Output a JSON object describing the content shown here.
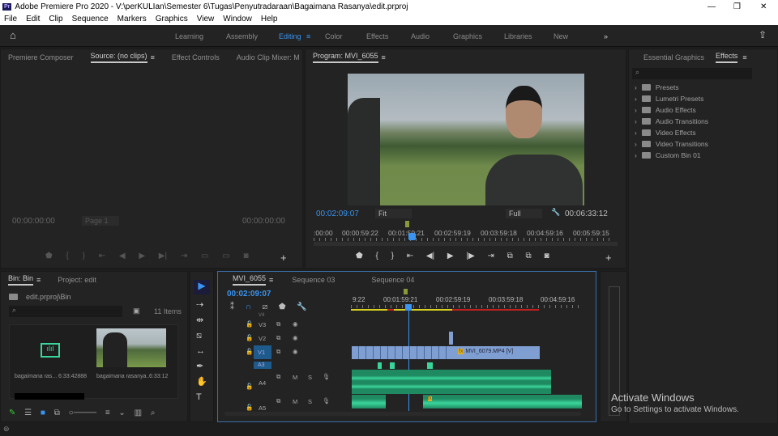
{
  "title": "Adobe Premiere Pro 2020 - V:\\perKULIan\\Semester 6\\Tugas\\Penyutradaraan\\Bagaimana Rasanya\\edit.prproj",
  "app_icon": "Pr",
  "window_controls": {
    "minimize": "—",
    "maximize": "❐",
    "close": "✕"
  },
  "menu": [
    "File",
    "Edit",
    "Clip",
    "Sequence",
    "Markers",
    "Graphics",
    "View",
    "Window",
    "Help"
  ],
  "workspaces": [
    "Learning",
    "Assembly",
    "Editing",
    "Color",
    "Effects",
    "Audio",
    "Graphics",
    "Libraries",
    "New"
  ],
  "active_workspace": "Editing",
  "source_panel": {
    "tabs": [
      "Premiere Composer",
      "Source: (no clips)",
      "Effect Controls",
      "Audio Clip Mixer: M"
    ],
    "timecode_left": "00:00:00:00",
    "timecode_right": "00:00:00:00",
    "page": "Page 1"
  },
  "program_panel": {
    "title": "Program: MVI_6055",
    "timecode": "00:02:09:07",
    "fit": "Fit",
    "quality": "Full",
    "duration": "00:06:33:12",
    "ruler": [
      ":00:00",
      "00:00:59:22",
      "00:01:59:21",
      "00:02:59:19",
      "00:03:59:18",
      "00:04:59:16",
      "00:05:59:15"
    ]
  },
  "effects_panel": {
    "tabs": [
      "Essential Graphics",
      "Effects"
    ],
    "items": [
      "Presets",
      "Lumetri Presets",
      "Audio Effects",
      "Audio Transitions",
      "Video Effects",
      "Video Transitions",
      "Custom Bin 01"
    ]
  },
  "bin_panel": {
    "tabs": [
      "Bin: Bin",
      "Project: edit"
    ],
    "path": "edit.prproj\\Bin",
    "count": "11 Items",
    "clips": [
      {
        "name": "bagaimana ras...",
        "duration": "6:33:42888"
      },
      {
        "name": "bagaimana rasanya...",
        "duration": "6:33:12"
      }
    ]
  },
  "timeline": {
    "tabs": [
      "MVI_6055",
      "Sequence 03",
      "Sequence 04"
    ],
    "timecode": "00:02:09:07",
    "ruler": [
      "9:22",
      "00:01:59:21",
      "00:02:59:19",
      "00:03:59:18",
      "00:04:59:16"
    ],
    "tracks": [
      "V4",
      "V3",
      "V2",
      "V1",
      "A3",
      "A4",
      "A5"
    ],
    "clip": "MVI_6079.MP4 [V]",
    "fx": "fx",
    "m": "M",
    "s": "S"
  },
  "watermark": {
    "title": "Activate Windows",
    "subtitle": "Go to Settings to activate Windows."
  },
  "colors": {
    "accent": "#3a94f0",
    "video_clip": "#7f9fd3",
    "audio_clip": "#1f8a62"
  }
}
